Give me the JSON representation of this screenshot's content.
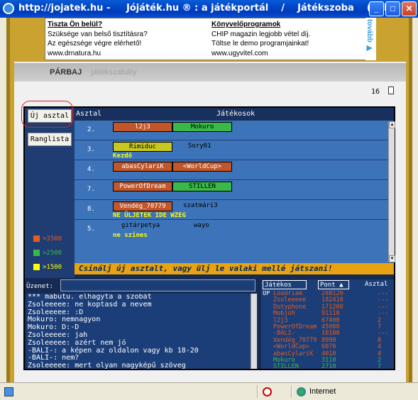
{
  "window": {
    "title": "http://jojatek.hu -     Jójáték.hu ® : a játékportál    /    Játékszoba    (onli..."
  },
  "ads": [
    {
      "title": "Tiszta Ön belül?",
      "line1": "Szüksége van belső tisztításra?",
      "line2": "Az egészsége végre elérhető!",
      "url": "www.drnatura.hu"
    },
    {
      "title": "Könyvelőprogramok",
      "line1": "CHIP magazin legjobb vétel díj.",
      "line2": "Töltse le demo programjainkat!",
      "url": "www.ugyvitel.com"
    }
  ],
  "tovabb": "tovább ▶",
  "nav": {
    "item1": "PÁRBAJ",
    "item2": "játékszabály"
  },
  "counter": "16",
  "buttons": {
    "new_table": "Új asztal",
    "ranking": "Ranglista"
  },
  "legend": [
    {
      "label": ">3500",
      "color": "#e85b1a"
    },
    {
      "label": ">2500",
      "color": "#3ab84a"
    },
    {
      "label": ">1500",
      "color": "#ffff00"
    }
  ],
  "table_header": {
    "table": "Asztal",
    "players": "Játékosok"
  },
  "tables": [
    {
      "num": "2.",
      "p1": "l2j3",
      "p1_color": "#c0562a",
      "p2": "Mokuro",
      "p2_color": "#3ab84a",
      "sub": ""
    },
    {
      "num": "3.",
      "p1": "Rimiduc",
      "p1_color": "#c8c820",
      "p2": "Sory01",
      "p2_color": "",
      "sub": "Kezdő"
    },
    {
      "num": "4.",
      "p1": "abasCylariK",
      "p1_color": "#c0562a",
      "p2": "<WorldCup>",
      "p2_color": "#c0562a",
      "sub": ""
    },
    {
      "num": "7.",
      "p1": "PowerOfDream",
      "p1_color": "#c0562a",
      "p2": "STILLEN",
      "p2_color": "#3ab84a",
      "sub": ""
    },
    {
      "num": "8.",
      "p1": "Vendég_70779",
      "p1_color": "#c0562a",
      "p2": "szatmári3",
      "p2_color": "",
      "sub": "NE ÜLJETEK IDE WZEG"
    },
    {
      "num": "5.",
      "p1": "gitárpetya",
      "p1_color": "",
      "p2": "wayo",
      "p2_color": "",
      "sub": "ne szines"
    }
  ],
  "banner": "Csinálj új asztalt, vagy ülj le valaki mellé játszani!",
  "message_label": "Üzenet:",
  "chat": [
    "*** mabutu. elhagyta a szobát",
    "Zsoleeeee: ne koptasd a nevem",
    "Zsoleeeee: :D",
    "Mokuro: nemnagyon",
    "Mokuro: D:-D",
    "Zsoleeeee: jah",
    "Zsoleeeee: azért nem jó",
    "-BALI-: a képen az oldalon vagy kb 18-20",
    "-BALI-: nem?",
    "Zsoleeeee: mert olyan nagyképű szöveg"
  ],
  "players_header": {
    "player": "Játékos",
    "points": "Pont",
    "table": "Asztal"
  },
  "players": [
    {
      "prefix": "OP",
      "name": "Loddriam",
      "points": "288120",
      "table": "---",
      "color": "#e85b1a"
    },
    {
      "prefix": "",
      "name": "Zsoleeeee",
      "points": "182410",
      "table": "---",
      "color": "#e85b1a"
    },
    {
      "prefix": "",
      "name": "Dutyphone",
      "points": "171200",
      "table": "---",
      "color": "#e85b1a"
    },
    {
      "prefix": "",
      "name": "Mobjoh",
      "points": "91110",
      "table": "---",
      "color": "#e85b1a"
    },
    {
      "prefix": "",
      "name": "l2j3",
      "points": "67400",
      "table": "2",
      "color": "#e85b1a"
    },
    {
      "prefix": "",
      "name": "PowerOfDream",
      "points": "45080",
      "table": "7",
      "color": "#e85b1a"
    },
    {
      "prefix": "",
      "name": "-BALI-",
      "points": "10100",
      "table": "---",
      "color": "#e85b1a"
    },
    {
      "prefix": "",
      "name": "Vendég_70779",
      "points": "8090",
      "table": "8",
      "color": "#e85b1a"
    },
    {
      "prefix": "",
      "name": "<WorldCup>",
      "points": "6070",
      "table": "4",
      "color": "#e85b1a"
    },
    {
      "prefix": "",
      "name": "abasCylariK",
      "points": "4010",
      "table": "4",
      "color": "#e85b1a"
    },
    {
      "prefix": "",
      "name": "Mokuro",
      "points": "3110",
      "table": "2",
      "color": "#3ab84a"
    },
    {
      "prefix": "",
      "name": "STILLEN",
      "points": "2710",
      "table": "7",
      "color": "#3ab84a"
    }
  ],
  "status": {
    "zone": "Internet"
  }
}
